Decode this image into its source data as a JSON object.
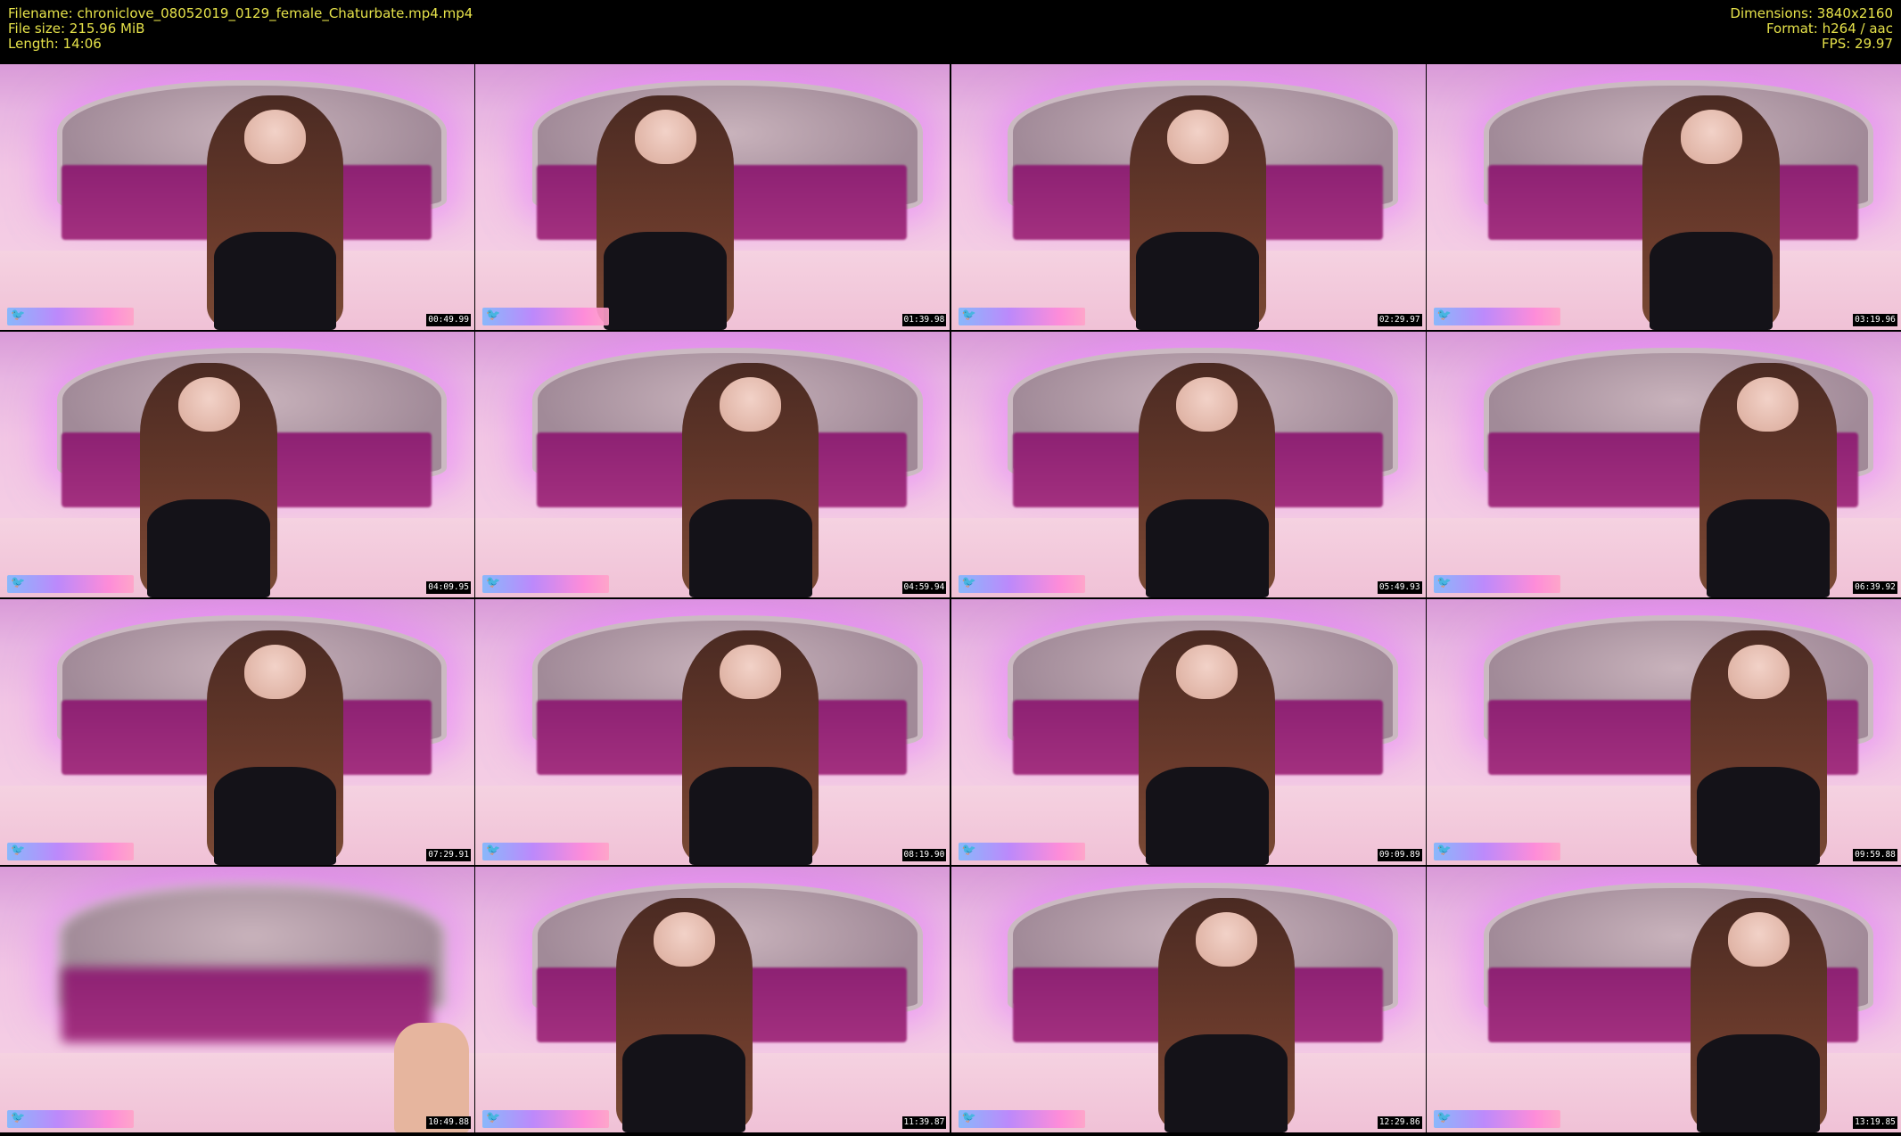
{
  "header": {
    "filename": "Filename: chroniclove_08052019_0129_female_Chaturbate.mp4.mp4",
    "filesize": "File size: 215.96 MiB",
    "length": "Length: 14:06",
    "dimensions": "Dimensions: 3840x2160",
    "format": "Format: h264 / aac",
    "fps": "FPS: 29.97"
  },
  "colors": {
    "header_text": "#e6e24a",
    "background": "#000000",
    "timestamp_bg": "#000000",
    "timestamp_text": "#ffffff"
  },
  "thumbnails": [
    {
      "timestamp": "00:49.99",
      "icon": "twitter-bird-icon"
    },
    {
      "timestamp": "01:39.98",
      "icon": "twitter-bird-icon"
    },
    {
      "timestamp": "02:29.97",
      "icon": "twitter-bird-icon"
    },
    {
      "timestamp": "03:19.96",
      "icon": "twitter-bird-icon"
    },
    {
      "timestamp": "04:09.95",
      "icon": "twitter-bird-icon"
    },
    {
      "timestamp": "04:59.94",
      "icon": "twitter-bird-icon"
    },
    {
      "timestamp": "05:49.93",
      "icon": "twitter-bird-icon"
    },
    {
      "timestamp": "06:39.92",
      "icon": "twitter-bird-icon"
    },
    {
      "timestamp": "07:29.91",
      "icon": "twitter-bird-icon"
    },
    {
      "timestamp": "08:19.90",
      "icon": "twitter-bird-icon"
    },
    {
      "timestamp": "09:09.89",
      "icon": "twitter-bird-icon"
    },
    {
      "timestamp": "09:59.88",
      "icon": "twitter-bird-icon"
    },
    {
      "timestamp": "10:49.88",
      "icon": "twitter-bird-icon"
    },
    {
      "timestamp": "11:39.87",
      "icon": "twitter-bird-icon"
    },
    {
      "timestamp": "12:29.86",
      "icon": "twitter-bird-icon"
    },
    {
      "timestamp": "13:19.85",
      "icon": "twitter-bird-icon"
    }
  ]
}
